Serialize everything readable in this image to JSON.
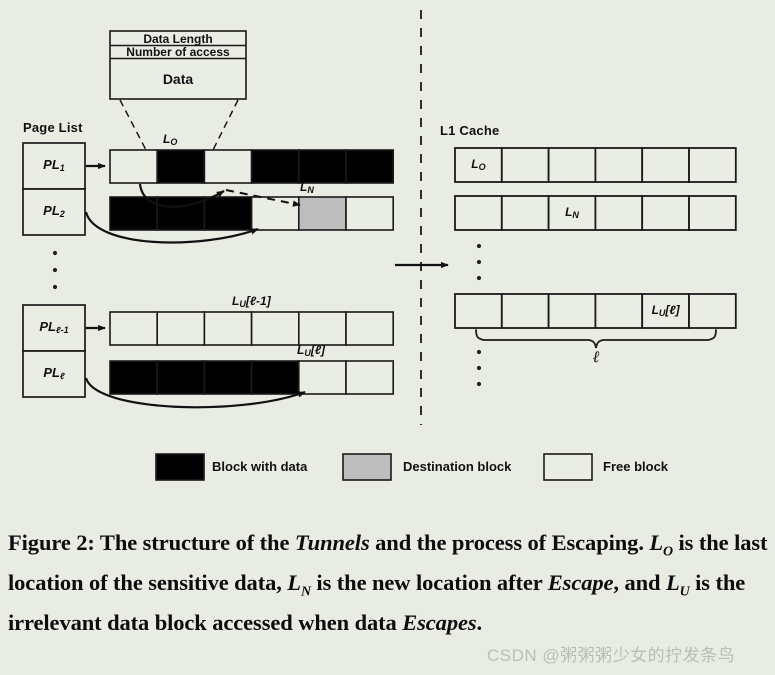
{
  "background_color": "#e8ece3",
  "colors": {
    "block_with_data": "#000000",
    "destination_block": "#bdbdbd",
    "free_block": "#e9ede4",
    "stroke": "#1a1a1a",
    "watermark": "#b9bfb4"
  },
  "data_struct": {
    "rows": [
      {
        "label": "Data Length"
      },
      {
        "label": "Number of access"
      },
      {
        "label": "Data"
      }
    ]
  },
  "page_list": {
    "title": "Page List",
    "items": [
      {
        "name": "PL",
        "sub": "1"
      },
      {
        "name": "PL",
        "sub": "2"
      },
      {
        "name": "PL",
        "sub": "ℓ-1"
      },
      {
        "name": "PL",
        "sub": "ℓ"
      }
    ],
    "ellipsis": "⋮"
  },
  "memory_rows": [
    {
      "id": "row-pl1",
      "label": "L",
      "label_sub": "O",
      "cells": [
        "free",
        "data",
        "free",
        "data",
        "data",
        "data"
      ]
    },
    {
      "id": "row-pl2",
      "label": "L",
      "label_sub": "N",
      "cells": [
        "data",
        "data",
        "data",
        "free",
        "dest",
        "free"
      ]
    },
    {
      "id": "row-pll-1",
      "label": "L",
      "label_sub": "U",
      "label_suffix": "[ℓ-1]",
      "cells": [
        "free",
        "free",
        "free",
        "free",
        "free",
        "free"
      ]
    },
    {
      "id": "row-pll",
      "label": "L",
      "label_sub": "U",
      "label_suffix": "[ℓ]",
      "cells": [
        "data",
        "data",
        "data",
        "data",
        "free",
        "free"
      ]
    }
  ],
  "cache": {
    "title": "L1 Cache",
    "rows": [
      {
        "cells": [
          "Lₒ",
          "",
          "",
          "",
          "",
          ""
        ],
        "marked_index": 0,
        "marked_label": "L",
        "marked_sub": "O"
      },
      {
        "cells": [
          "",
          "",
          "Lₙ",
          "",
          "",
          ""
        ],
        "marked_index": 2,
        "marked_label": "L",
        "marked_sub": "N"
      },
      {
        "cells": [
          "",
          "",
          "",
          "",
          "Lᴜ[ℓ]",
          ""
        ],
        "marked_index": 4,
        "marked_label": "L",
        "marked_sub": "U",
        "marked_suffix": "[ℓ]"
      }
    ],
    "brace_label": "ℓ",
    "ellipsis_top": "⋮",
    "ellipsis_bottom": "⋮"
  },
  "legend": {
    "items": [
      {
        "swatch": "data",
        "label": "Block with data"
      },
      {
        "swatch": "dest",
        "label": "Destination block"
      },
      {
        "swatch": "free",
        "label": "Free block"
      }
    ]
  },
  "caption": {
    "prefix": "Figure 2: The structure of the ",
    "em1": "Tunnels",
    "mid1": " and the process of Escaping. ",
    "var1": "L",
    "var1_sub": "O",
    "mid2": " is the last location of the sensitive data, ",
    "var2": "L",
    "var2_sub": "N",
    "mid3": " is the new location after ",
    "em2": "Escape",
    "mid4": ", and ",
    "var3": "L",
    "var3_sub": "U",
    "mid5": " is the irrelevant data block accessed when data ",
    "em3": "Escapes",
    "suffix": "."
  },
  "watermark": {
    "text": "CSDN @粥粥粥少女的拧发条鸟"
  }
}
